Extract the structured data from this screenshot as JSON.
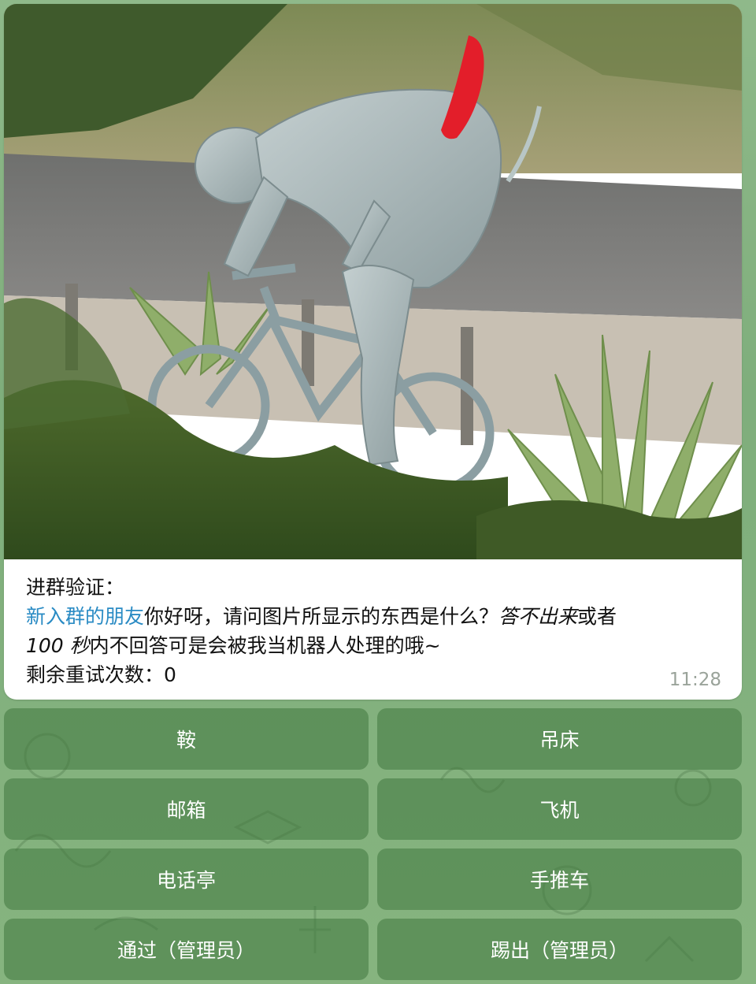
{
  "message": {
    "prefix": "进群验证：",
    "mention": "新入群的朋友",
    "question": "你好呀，请问图片所显示的东西是什么？",
    "italic1": "答不出来",
    "mid": "或者",
    "italic2": "100 秒",
    "tail": "内不回答可是会被我当机器人处理的哦~",
    "retries": "剩余重试次数：0",
    "time": "11:28"
  },
  "buttons": [
    {
      "label": "鞍"
    },
    {
      "label": "吊床"
    },
    {
      "label": "邮箱"
    },
    {
      "label": "飞机"
    },
    {
      "label": "电话亭"
    },
    {
      "label": "手推车"
    },
    {
      "label": "通过（管理员）"
    },
    {
      "label": "踢出（管理员）"
    }
  ],
  "colors": {
    "mention": "#2a8bc4",
    "button_bg": "#5a8f57",
    "wallpaper": "#86b47f"
  }
}
